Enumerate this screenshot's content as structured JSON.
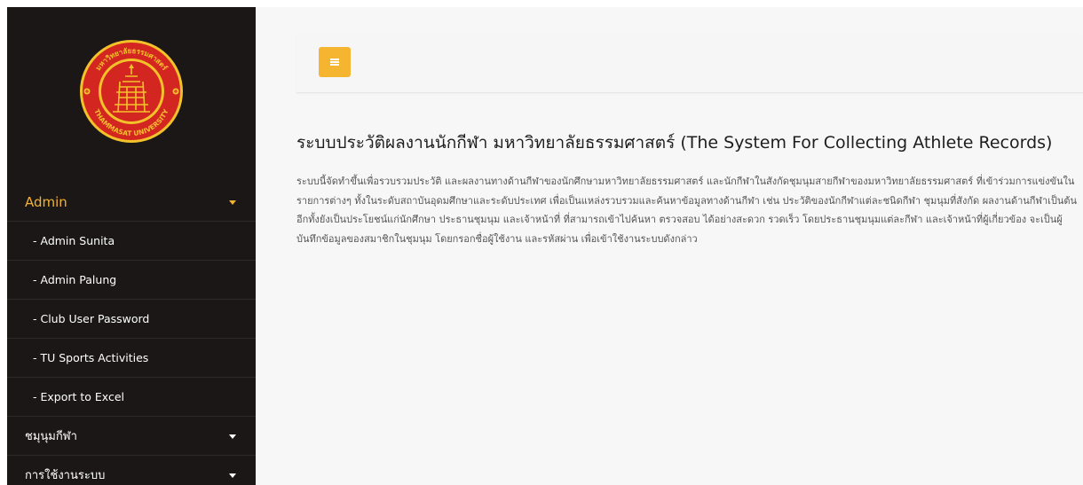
{
  "sidebar": {
    "logo_text": "มหาวิทยาลัยธรรมศาสตร์ THAMMASAT UNIVERSITY",
    "menu": [
      {
        "label": "Admin",
        "type": "group",
        "active": true
      },
      {
        "label": "- Admin Sunita",
        "type": "sub"
      },
      {
        "label": "- Admin Palung",
        "type": "sub"
      },
      {
        "label": "- Club User Password",
        "type": "sub"
      },
      {
        "label": "- TU Sports Activities",
        "type": "sub"
      },
      {
        "label": "- Export to Excel",
        "type": "sub"
      },
      {
        "label": "ชมุนุมกีฬา",
        "type": "group"
      },
      {
        "label": "การใช้งานระบบ",
        "type": "group"
      }
    ]
  },
  "header": {
    "toggle_icon": "menu-icon"
  },
  "main": {
    "title": "ระบบประวัติผลงานนักกีฬา มหาวิทยาลัยธรรมศาสตร์ (The System For Collecting Athlete Records)",
    "description": "ระบบนี้จัดทำขึ้นเพื่อรวบรวมประวัติ และผลงานทางด้านกีฬาของนักศึกษามหาวิทยาลัยธรรมศาสตร์ และนักกีฬาในสังกัดชุมนุมสายกีฬาของมหาวิทยาลัยธรรมศาสตร์ ที่เข้าร่วมการแข่งขันในรายการต่างๆ ทั้งในระดับสถาบันอุดมศึกษาและระดับประเทศ เพื่อเป็นแหล่งรวบรวมและค้นหาข้อมูลทางด้านกีฬา เช่น ประวัติของนักกีฬาแต่ละชนิดกีฬา ชุมนุมที่สังกัด ผลงานด้านกีฬาเป็นต้น อีกทั้งยังเป็นประโยชน์แก่นักศึกษา ประธานชุมนุม และเจ้าหน้าที่ ที่สามารถเข้าไปค้นหา ตรวจสอบ ได้อย่างสะดวก รวดเร็ว โดยประธานชุมนุมแต่ละกีฬา และเจ้าหน้าที่ผู้เกี่ยวข้อง จะเป็นผู้บันทึกข้อมูลของสมาชิกในชุมนุม โดยกรอกชื่อผู้ใช้งาน และรหัสผ่าน เพื่อเข้าใช้งานระบบดังกล่าว"
  },
  "colors": {
    "sidebar_bg": "#1a1716",
    "accent": "#f5b530",
    "seal_red": "#d42620",
    "seal_yellow": "#f3c22a"
  }
}
